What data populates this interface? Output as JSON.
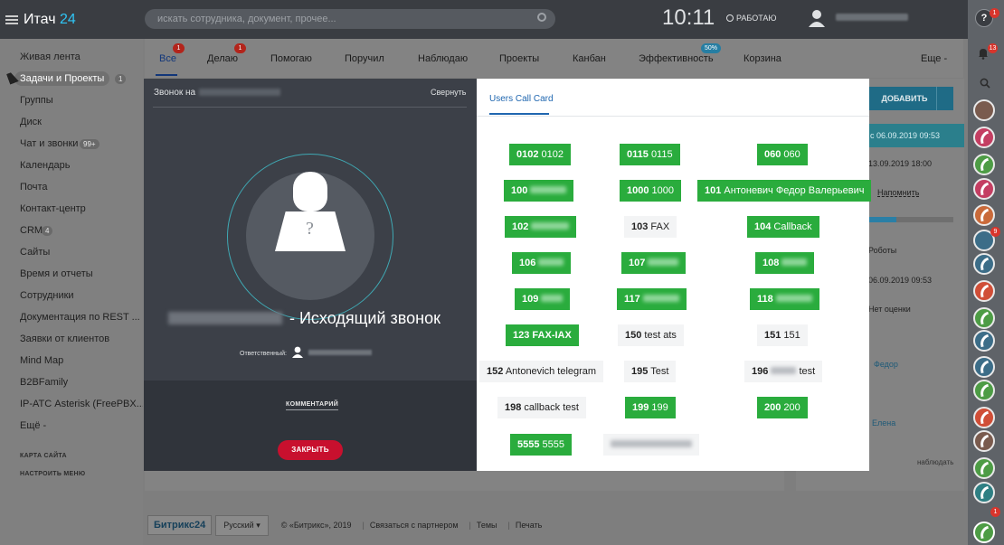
{
  "topbar": {
    "logo_main": "Итач",
    "logo_suffix": "24",
    "search_placeholder": "искать сотрудника, документ, прочее...",
    "clock": "10:11",
    "work_status": "РАБОТАЮ",
    "help_label": "?",
    "help_badge": "1"
  },
  "left_menu": {
    "items": [
      {
        "label": "Живая лента"
      },
      {
        "label": "Задачи и Проекты",
        "counter": "1"
      },
      {
        "label": "Группы"
      },
      {
        "label": "Диск"
      },
      {
        "label": "Чат и звонки",
        "counter": "99+"
      },
      {
        "label": "Календарь"
      },
      {
        "label": "Почта"
      },
      {
        "label": "Контакт-центр"
      },
      {
        "label": "CRM",
        "counter": "4"
      },
      {
        "label": "Сайты"
      },
      {
        "label": "Время и отчеты"
      },
      {
        "label": "Сотрудники"
      },
      {
        "label": "Документация по REST ..."
      },
      {
        "label": "Заявки от клиентов"
      },
      {
        "label": "Mind Map"
      },
      {
        "label": "B2BFamily"
      },
      {
        "label": "IP-АТС Asterisk (FreePBX..."
      },
      {
        "label": "Ещё -"
      }
    ],
    "sitemap": "КАРТА САЙТА",
    "settings": "НАСТРОИТЬ МЕНЮ"
  },
  "tabs": [
    {
      "label": "Все",
      "badge": "1"
    },
    {
      "label": "Делаю",
      "badge": "1"
    },
    {
      "label": "Помогаю"
    },
    {
      "label": "Поручил"
    },
    {
      "label": "Наблюдаю"
    },
    {
      "label": "Проекты"
    },
    {
      "label": "Канбан"
    },
    {
      "label": "Эффективность",
      "badge": "50%"
    },
    {
      "label": "Корзина"
    },
    {
      "label": "Еще -"
    }
  ],
  "right_column": {
    "add_button": "ДОБАВИТЬ",
    "band_text": "с 06.09.2019 09:53",
    "date1": "13.09.2019 18:00",
    "remind": "Напомнить",
    "robots": "Роботы",
    "date2": "06.09.2019 09:53",
    "no_rating": "Нет оценки",
    "person1": "Федор",
    "person2": "Елена",
    "watch": "наблюдать"
  },
  "right_strip": {
    "bell_badge": "13",
    "badge_2": "9",
    "badge_3": "1"
  },
  "footer": {
    "logo": "Битрикс24",
    "lang": "Русский",
    "copyright": "© «Битрикс», 2019",
    "partner": "Связаться с партнером",
    "themes": "Темы",
    "print": "Печать"
  },
  "call_card": {
    "call_to": "Звонок на",
    "collapse": "Свернуть",
    "call_type": "- Исходящий звонок",
    "responsible": "Ответственный:",
    "comment": "КОММЕНТАРИЙ",
    "close": "ЗАКРЫТЬ"
  },
  "users_card": {
    "tab": "Users Call Card",
    "extensions": [
      {
        "num": "0102",
        "name": "0102",
        "style": "green"
      },
      {
        "num": "0115",
        "name": "0115",
        "style": "green"
      },
      {
        "num": "060",
        "name": "060",
        "style": "green"
      },
      {
        "num": "100",
        "name": "",
        "style": "green"
      },
      {
        "num": "1000",
        "name": "1000",
        "style": "green"
      },
      {
        "num": "101",
        "name": "Антоневич Федор Валерьевич",
        "style": "green"
      },
      {
        "num": "102",
        "name": "",
        "style": "green"
      },
      {
        "num": "103",
        "name": "FAX",
        "style": "grey"
      },
      {
        "num": "104",
        "name": "Callback",
        "style": "green"
      },
      {
        "num": "106",
        "name": "",
        "style": "green"
      },
      {
        "num": "107",
        "name": "",
        "style": "green"
      },
      {
        "num": "108",
        "name": "",
        "style": "green"
      },
      {
        "num": "109",
        "name": "",
        "style": "green"
      },
      {
        "num": "117",
        "name": "",
        "style": "green"
      },
      {
        "num": "118",
        "name": "",
        "style": "green"
      },
      {
        "num": "123",
        "name": "FAX-IAX",
        "style": "green"
      },
      {
        "num": "150",
        "name": "test ats",
        "style": "grey"
      },
      {
        "num": "151",
        "name": "151",
        "style": "grey"
      },
      {
        "num": "152",
        "name": "Antonevich telegram",
        "style": "grey"
      },
      {
        "num": "195",
        "name": "Test",
        "style": "grey"
      },
      {
        "num": "196",
        "name": "test",
        "style": "grey"
      },
      {
        "num": "198",
        "name": "callback test",
        "style": "grey"
      },
      {
        "num": "199",
        "name": "199",
        "style": "green"
      },
      {
        "num": "200",
        "name": "200",
        "style": "green"
      },
      {
        "num": "5555",
        "name": "5555",
        "style": "green"
      },
      {
        "num": "",
        "name": "",
        "style": "grey"
      }
    ]
  },
  "colors": {
    "accent_green": "#2aac3d",
    "accent_blue": "#2067b0",
    "close_red": "#c8102e"
  }
}
